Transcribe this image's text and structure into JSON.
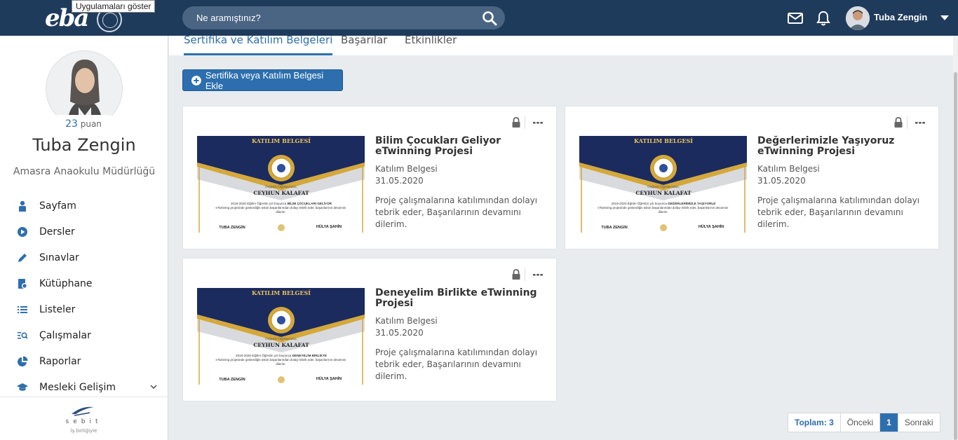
{
  "header": {
    "logo_text": "eba",
    "tooltip": "Uygulamaları göster",
    "search_placeholder": "Ne aramıştınız?",
    "user_name": "Tuba Zengin"
  },
  "profile": {
    "points_value": "23",
    "points_label": "puan",
    "name": "Tuba Zengin",
    "school": "Amasra Anaokulu Müdürlüğü"
  },
  "nav": {
    "items": [
      {
        "label": "Sayfam",
        "icon": "person-icon"
      },
      {
        "label": "Dersler",
        "icon": "play-circle-icon"
      },
      {
        "label": "Sınavlar",
        "icon": "pencil-icon"
      },
      {
        "label": "Kütüphane",
        "icon": "library-icon"
      },
      {
        "label": "Listeler",
        "icon": "list-icon"
      },
      {
        "label": "Çalışmalar",
        "icon": "search-list-icon"
      },
      {
        "label": "Raporlar",
        "icon": "pie-chart-icon"
      },
      {
        "label": "Mesleki Gelişim",
        "icon": "graduation-cap-icon"
      }
    ]
  },
  "footer": {
    "brand": "sebit",
    "tagline": "İş birliğiyle"
  },
  "tabs": [
    {
      "label": "Sertifika ve Katılım Belgeleri",
      "active": true
    },
    {
      "label": "Başarılar",
      "active": false
    },
    {
      "label": "Etkinlikler",
      "active": false
    }
  ],
  "add_button_label": "Sertifika veya Katılım Belgesi Ekle",
  "certificate_template": {
    "heading": "KATILIM BELGESİ",
    "recipient_prefix": "Değerli Öğrencimiz,",
    "recipient": "CEYHUN KALAFAT",
    "signer_left": "TUBA ZENGİN",
    "signer_right": "HÜLYA ŞAHİN"
  },
  "cards": [
    {
      "title": "Bilim Çocukları Geliyor eTwinning Projesi",
      "type": "Katılım Belgesi",
      "date": "31.05.2020",
      "description": "Proje çalışmalarına katılımından dolayı tebrik eder, Başarılarının devamını dilerim.",
      "cert_body_1": "2019-2020 Eğitim Öğretim yılı boyunca",
      "cert_project": "BİLİM ÇOCUKLARI GELİYOR",
      "cert_body_2": "eTwinning projesinde gösterdiğin üstün başarılarından dolayı tebrik eder, başarılarının devamını dilerim."
    },
    {
      "title": "Değerlerimizle Yaşıyoruz eTwinning Projesi",
      "type": "Katılım Belgesi",
      "date": "31.05.2020",
      "description": "Proje çalışmalarına katılımından dolayı tebrik eder, Başarılarının devamını dilerim.",
      "cert_body_1": "2019-2020 Eğitim Öğretim yılı boyunca",
      "cert_project": "DEĞERLERİMİZLE YAŞIYORUZ",
      "cert_body_2": "eTwinning projesinde gösterdiğin üstün başarılarından dolayı tebrik eder, başarılarının devamını dilerim."
    },
    {
      "title": "Deneyelim Birlikte eTwinning Projesi",
      "type": "Katılım Belgesi",
      "date": "31.05.2020",
      "description": "Proje çalışmalarına katılımından dolayı tebrik eder, Başarılarının devamını dilerim.",
      "cert_body_1": "2019-2020 Eğitim Öğretim yılı boyunca",
      "cert_project": "DENEYELİM BİRLİKTE",
      "cert_body_2": "eTwinning projesinde gösterdiğin üstün başarılarından dolayı tebrik eder, başarılarının devamını dilerim."
    }
  ],
  "pagination": {
    "total": "Toplam: 3",
    "prev": "Önceki",
    "current": "1",
    "next": "Sonraki"
  },
  "colors": {
    "topbar": "#1f3b5c",
    "accent": "#2d6fae",
    "gold": "#d4a83a",
    "navy": "#1c2b5e"
  }
}
